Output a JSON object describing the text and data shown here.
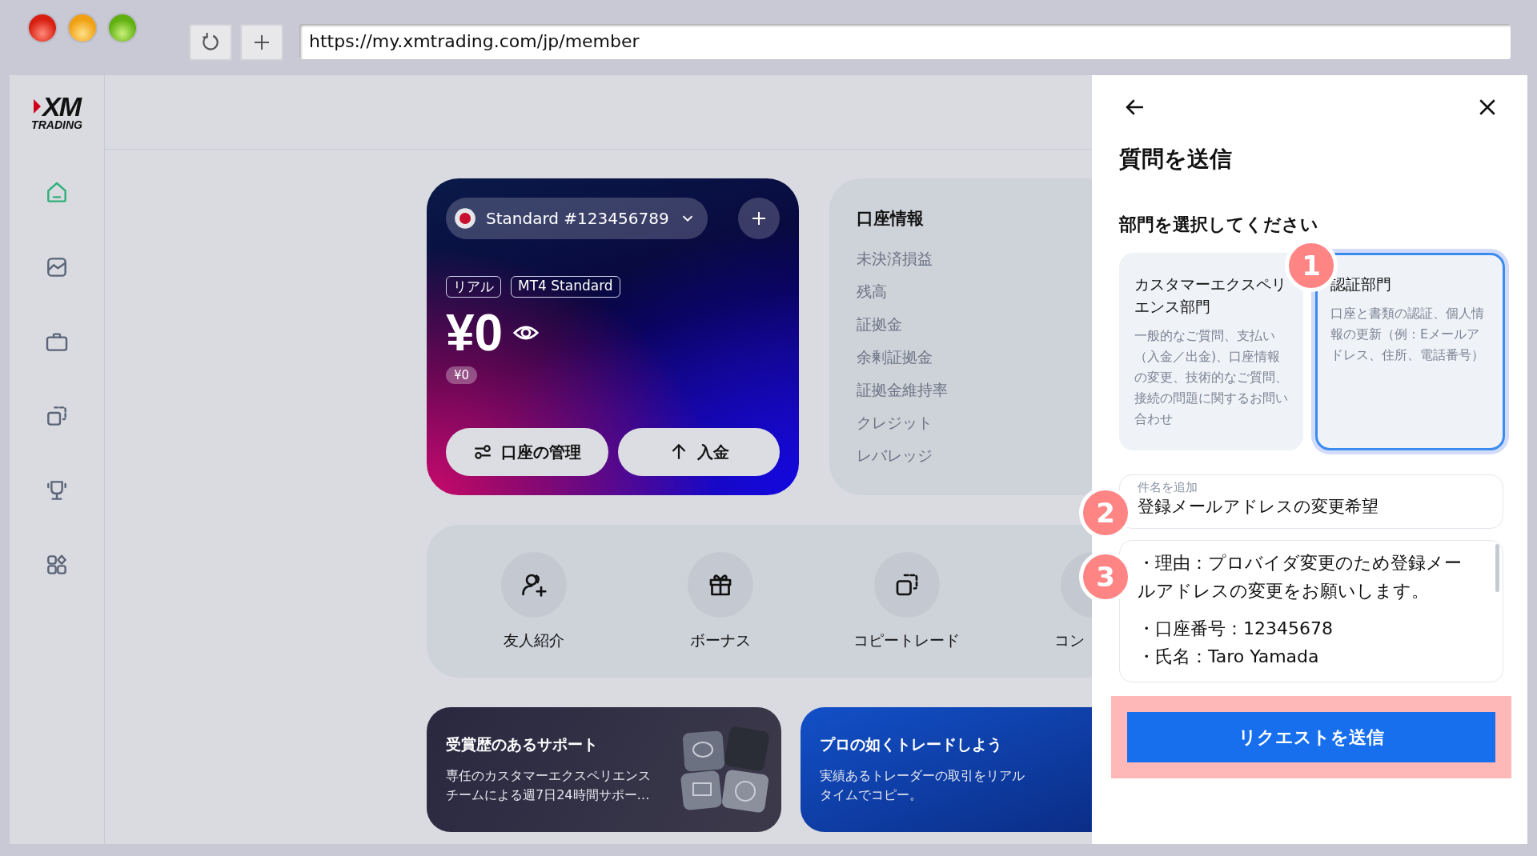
{
  "browser": {
    "url": "https://my.xmtrading.com/jp/member"
  },
  "logo": {
    "mark": "XM",
    "sub": "TRADING"
  },
  "sidebar": {
    "items": [
      {
        "kind": "home",
        "selected": true
      },
      {
        "kind": "chart",
        "selected": false
      },
      {
        "kind": "briefcase",
        "selected": false
      },
      {
        "kind": "copy",
        "selected": false
      },
      {
        "kind": "trophy",
        "selected": false
      },
      {
        "kind": "apps",
        "selected": false
      }
    ]
  },
  "account_card": {
    "account": "Standard #123456789",
    "tags": [
      "リアル",
      "MT4 Standard"
    ],
    "balance": "¥0",
    "sub_balance": "¥0",
    "buttons": [
      {
        "kind": "manage",
        "label": "口座の管理"
      },
      {
        "kind": "deposit",
        "label": "入金"
      }
    ]
  },
  "account_info": {
    "title": "口座情報",
    "rows": [
      "未決済損益",
      "残高",
      "証拠金",
      "余剰証拠金",
      "証拠金維持率",
      "クレジット",
      "レバレッジ"
    ]
  },
  "shortcuts": [
    {
      "kind": "referral",
      "label": "友人紹介"
    },
    {
      "kind": "bonus",
      "label": "ボーナス"
    },
    {
      "kind": "copy",
      "label": "コピートレード"
    },
    {
      "kind": "other",
      "label": "コン"
    }
  ],
  "banners": [
    {
      "kind": "support",
      "title": "受賞歴のあるサポート",
      "text": "専任のカスタマーエクスペリエンスチームによる週7日24時間サポー…"
    },
    {
      "kind": "copytrade",
      "title": "プロの如くトレードしよう",
      "text": "実績あるトレーダーの取引をリアルタイムでコピー。"
    }
  ],
  "panel": {
    "title": "質問を送信",
    "subtitle": "部門を選択してください",
    "departments": [
      {
        "title": "カスタマーエクスペリエンス部門",
        "description": "一般的なご質問、支払い（入金／出金)、口座情報の変更、技術的なご質問、接続の問題に関するお問い合わせ",
        "selected": false
      },
      {
        "title": "認証部門",
        "description": "口座と書類の認証、個人情報の更新（例：Eメールアドレス、住所、電話番号）",
        "selected": true
      }
    ],
    "subject": {
      "label": "件名を追加",
      "value": "登録メールアドレスの変更希望"
    },
    "message": [
      "・理由：プロバイダ変更のため登録メールアドレスの変更をお願いします。",
      "・口座番号：12345678",
      "・氏名：Taro Yamada"
    ],
    "submit": "リクエストを送信"
  },
  "annotations": [
    "1",
    "2",
    "3"
  ]
}
